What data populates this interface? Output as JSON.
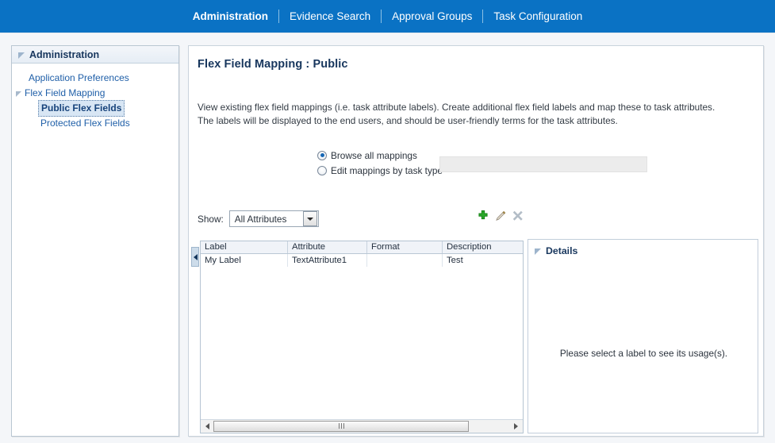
{
  "topnav": {
    "items": [
      {
        "label": "Administration",
        "active": true
      },
      {
        "label": "Evidence Search",
        "active": false
      },
      {
        "label": "Approval Groups",
        "active": false
      },
      {
        "label": "Task Configuration",
        "active": false
      }
    ],
    "background_color": "#0a72c4",
    "text_color": "#ffffff"
  },
  "sidebar": {
    "header_title": "Administration",
    "items": [
      {
        "label": "Application Preferences",
        "level": 1,
        "has_arrow": false,
        "selected": false
      },
      {
        "label": "Flex Field Mapping",
        "level": 1,
        "has_arrow": true,
        "selected": false
      },
      {
        "label": "Public Flex Fields",
        "level": 2,
        "has_arrow": false,
        "selected": true
      },
      {
        "label": "Protected Flex Fields",
        "level": 2,
        "has_arrow": false,
        "selected": false
      }
    ]
  },
  "main": {
    "page_title": "Flex Field Mapping : Public",
    "description_line1": "View existing flex field mappings (i.e. task attribute labels). Create additional flex field labels and map these to task attributes.",
    "description_line2": "The labels will be displayed to the end users, and should be user-friendly terms for the task attributes.",
    "mode_options": [
      {
        "label": "Browse all mappings",
        "checked": true
      },
      {
        "label": "Edit mappings by task type",
        "checked": false
      }
    ],
    "task_type_field_value": "",
    "show_label": "Show:",
    "show_selected": "All Attributes",
    "show_options": [
      "All Attributes"
    ],
    "toolbar": [
      {
        "name": "add-icon",
        "tooltip": "Add",
        "color": "#2ca02c"
      },
      {
        "name": "edit-icon",
        "tooltip": "Edit",
        "color": "#b08b4f"
      },
      {
        "name": "delete-icon",
        "tooltip": "Delete",
        "color": "#a9b4bf"
      }
    ],
    "table": {
      "columns": [
        "Label",
        "Attribute",
        "Format",
        "Description"
      ],
      "rows": [
        {
          "Label": "My Label",
          "Attribute": "TextAttribute1",
          "Format": "",
          "Description": "Test"
        }
      ]
    },
    "details": {
      "title": "Details",
      "empty_message": "Please select a label to see its usage(s)."
    }
  }
}
